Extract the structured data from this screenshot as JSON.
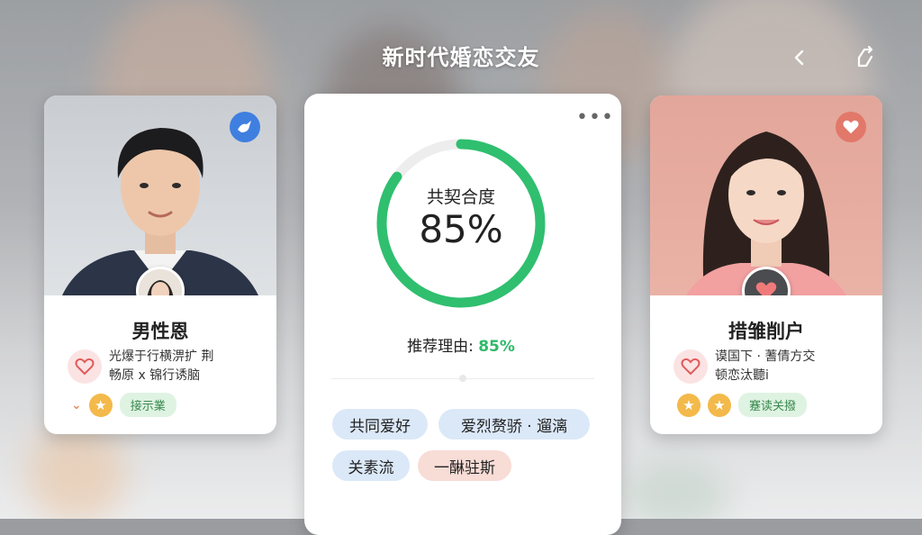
{
  "header": {
    "title": "新时代婚恋交友",
    "back_icon": "chevron-left-icon",
    "share_icon": "share-icon"
  },
  "left_card": {
    "name": "男性恩",
    "desc_line1": "光爆于行横淠扩 荆",
    "desc_line2": "畅原 ⅹ 锦行诱脑",
    "tag": "接示業",
    "badge_icon": "bird-icon",
    "heart_icon": "heart-outline-icon"
  },
  "match": {
    "label": "共契合度",
    "value_text": "85%",
    "percent": 85,
    "reason_label": "推荐理由: ",
    "reason_value": "85%",
    "tags": [
      "共同爱好",
      "爱烈赘骄 · 遛漓",
      "关素流",
      "一醂驻斯"
    ],
    "color": "#2fbf6f"
  },
  "right_card": {
    "name": "措雏削户",
    "desc_line1": "谟国下 · 蓍倩方交",
    "desc_line2": "顿恋汰聽i",
    "tag": "蹇读关撥",
    "badge_icon": "heart-badge-icon",
    "heart_icon": "heart-outline-icon"
  }
}
